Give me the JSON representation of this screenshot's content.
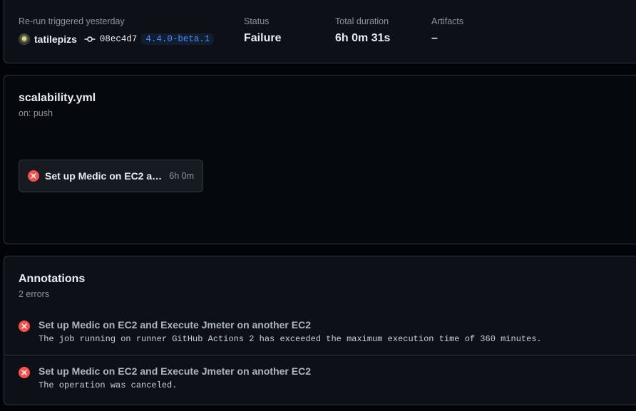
{
  "summary": {
    "trigger_label": "Re-run triggered yesterday",
    "user": "tatilepizs",
    "commit_sha": "08ec4d7",
    "branch": "4.4.0-beta.1",
    "status_label": "Status",
    "status_value": "Failure",
    "duration_label": "Total duration",
    "duration_value": "6h 0m 31s",
    "artifacts_label": "Artifacts",
    "artifacts_value": "–"
  },
  "workflow": {
    "file": "scalability.yml",
    "trigger": "on: push",
    "job": {
      "name": "Set up Medic on EC2 and Execute Jmeter on another EC2",
      "duration": "6h 0m",
      "status": "failure"
    }
  },
  "annotations": {
    "title": "Annotations",
    "count": "2 errors",
    "items": [
      {
        "job": "Set up Medic on EC2 and Execute Jmeter on another EC2",
        "message": "The job running on runner GitHub Actions 2 has exceeded the maximum execution time of 360 minutes."
      },
      {
        "job": "Set up Medic on EC2 and Execute Jmeter on another EC2",
        "message": "The operation was canceled."
      }
    ]
  },
  "colors": {
    "background": "#010409",
    "card": "#0d1117",
    "border": "#30363d",
    "error": "#f85149",
    "link": "#4493f8",
    "muted": "#8b949e"
  },
  "icons": {
    "error": "x-circle-fill-icon",
    "commit": "git-commit-icon"
  }
}
